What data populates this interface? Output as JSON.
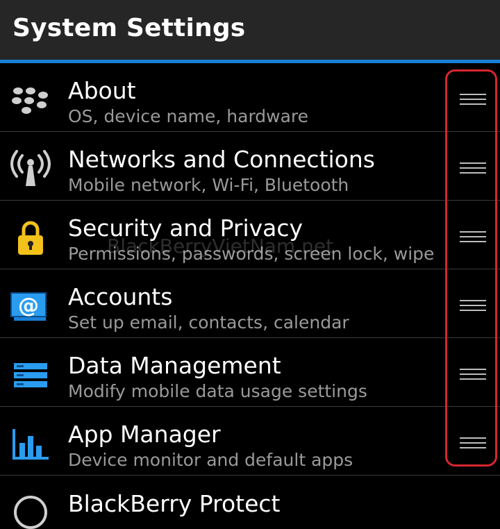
{
  "header": {
    "title": "System Settings"
  },
  "colors": {
    "accent": "#1a7fd6",
    "highlight": "#d8262f",
    "lock": "#f2c21b"
  },
  "items": [
    {
      "title": "About",
      "subtitle": "OS, device name, hardware",
      "icon": "blackberry-logo-icon"
    },
    {
      "title": "Networks and Connections",
      "subtitle": "Mobile network, Wi-Fi, Bluetooth",
      "icon": "antenna-icon"
    },
    {
      "title": "Security and Privacy",
      "subtitle": "Permissions, passwords, screen lock, wipe",
      "icon": "lock-icon"
    },
    {
      "title": "Accounts",
      "subtitle": "Set up email, contacts, calendar",
      "icon": "at-sign-icon"
    },
    {
      "title": "Data Management",
      "subtitle": "Modify mobile data usage settings",
      "icon": "data-management-icon"
    },
    {
      "title": "App Manager",
      "subtitle": "Device monitor and default apps",
      "icon": "bar-chart-icon"
    }
  ],
  "partial_item": {
    "title": "BlackBerry Protect",
    "icon": "protect-icon"
  },
  "watermark": "BlackBerryVietNam.net"
}
